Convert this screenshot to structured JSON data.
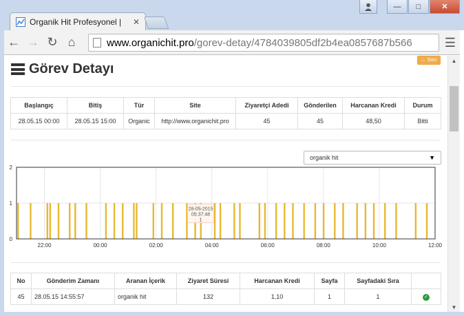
{
  "browser": {
    "tab_title": "Organik Hit Profesyonel |",
    "url_host": "www.organichit.pro",
    "url_path": "/gorev-detay/4784039805df2b4ea0857687b566"
  },
  "page": {
    "title": "Görev Detayı",
    "back_label": "Geri"
  },
  "summary": {
    "headers": [
      "Başlangıç",
      "Bitiş",
      "Tür",
      "Site",
      "Ziyaretçi Adedi",
      "Gönderilen",
      "Harcanan Kredi",
      "Durum"
    ],
    "row": [
      "28.05.15 00:00",
      "28.05.15 15:00",
      "Organic",
      "http://www.organichit.pro",
      "45",
      "45",
      "48,50",
      "Bitti"
    ]
  },
  "keyword_select": {
    "selected": "organik hit"
  },
  "chart_data": {
    "type": "bar",
    "title": "",
    "xlabel": "",
    "ylabel": "",
    "ylim": [
      0,
      2
    ],
    "y_ticks": [
      "0",
      "1",
      "2"
    ],
    "x_ticks": [
      "22:00",
      "00:00",
      "02:00",
      "04:00",
      "06:00",
      "08:00",
      "10:00",
      "12:00"
    ],
    "xlim_hours": [
      -3.0,
      12.0
    ],
    "series_color": "#e8b830",
    "bars_hours": [
      -2.95,
      -2.5,
      -1.9,
      -1.8,
      -1.5,
      -1.1,
      -0.9,
      -0.5,
      0.2,
      0.5,
      0.8,
      1.2,
      1.3,
      1.9,
      2.2,
      2.6,
      3.1,
      3.4,
      3.6,
      4.1,
      4.3,
      4.8,
      5.0,
      5.7,
      5.9,
      6.3,
      6.6,
      6.9,
      7.3,
      7.7,
      8.0,
      8.4,
      8.7,
      9.2,
      9.5,
      9.8,
      10.2,
      10.6,
      11.3,
      11.7
    ],
    "bar_value": 1,
    "tooltip": {
      "line1": "28-05-2015",
      "line2": "05:37:48",
      "line3": "1",
      "hour": 3.6
    }
  },
  "detail": {
    "headers": [
      "No",
      "Gönderim Zamanı",
      "Aranan İçerik",
      "Ziyaret Süresi",
      "Harcanan Kredi",
      "Sayfa",
      "Sayfadaki Sıra",
      ""
    ],
    "row": [
      "45",
      "28.05.15 14:55:57",
      "organik hit",
      "132",
      "1,10",
      "1",
      "1"
    ]
  },
  "colors": {
    "accent": "#f0ad4e",
    "bar": "#e8b830",
    "ok": "#2e9b3c"
  }
}
